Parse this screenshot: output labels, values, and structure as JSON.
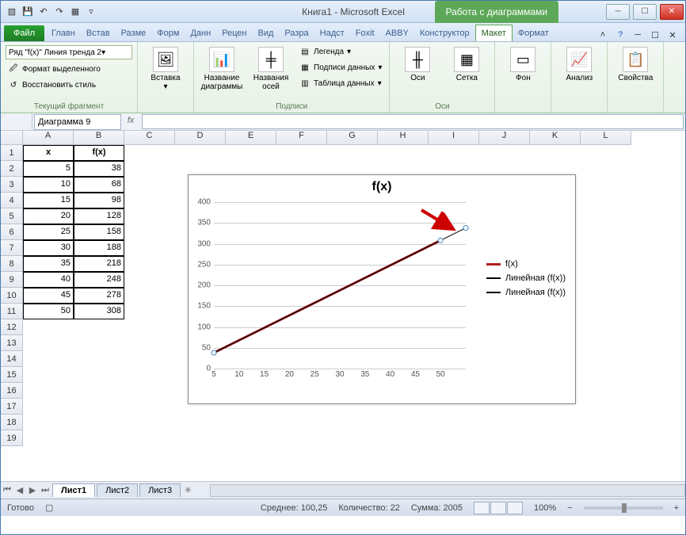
{
  "window": {
    "title_doc": "Книга1",
    "title_app": "Microsoft Excel",
    "chart_tools": "Работа с диаграммами"
  },
  "tabs": {
    "file": "Файл",
    "items": [
      "Главн",
      "Встав",
      "Разме",
      "Форм",
      "Данн",
      "Рецен",
      "Вид",
      "Разра",
      "Надст",
      "Foxit",
      "ABBY"
    ],
    "chart_ctx": [
      "Конструктор",
      "Макет",
      "Формат"
    ],
    "active": "Макет"
  },
  "ribbon": {
    "selection_combo": "Ряд \"f(x)\" Линия тренда 2",
    "format_selection": "Формат выделенного",
    "reset_style": "Восстановить стиль",
    "group_current": "Текущий фрагмент",
    "insert": "Вставка",
    "chart_title": "Название диаграммы",
    "axis_titles": "Названия осей",
    "legend": "Легенда",
    "data_labels": "Подписи данных",
    "data_table": "Таблица данных",
    "group_labels": "Подписи",
    "axes": "Оси",
    "gridlines": "Сетка",
    "group_axes": "Оси",
    "background": "Фон",
    "analysis": "Анализ",
    "properties": "Свойства"
  },
  "namebox": "Диаграмма 9",
  "sheet": {
    "headers": {
      "A": "x",
      "B": "f(x)"
    },
    "rows": [
      {
        "x": 5,
        "fx": 38
      },
      {
        "x": 10,
        "fx": 68
      },
      {
        "x": 15,
        "fx": 98
      },
      {
        "x": 20,
        "fx": 128
      },
      {
        "x": 25,
        "fx": 158
      },
      {
        "x": 30,
        "fx": 188
      },
      {
        "x": 35,
        "fx": 218
      },
      {
        "x": 40,
        "fx": 248
      },
      {
        "x": 45,
        "fx": 278
      },
      {
        "x": 50,
        "fx": 308
      }
    ],
    "col_letters": [
      "A",
      "B",
      "C",
      "D",
      "E",
      "F",
      "G",
      "H",
      "I",
      "J",
      "K",
      "L"
    ]
  },
  "chart_data": {
    "type": "line",
    "title": "f(x)",
    "x": [
      5,
      10,
      15,
      20,
      25,
      30,
      35,
      40,
      45,
      50
    ],
    "series": [
      {
        "name": "f(x)",
        "values": [
          38,
          68,
          98,
          128,
          158,
          188,
          218,
          248,
          278,
          308
        ],
        "color": "#b02020",
        "width": 3
      },
      {
        "name": "Линейная (f(x))",
        "values": [
          38,
          68,
          98,
          128,
          158,
          188,
          218,
          248,
          278,
          308
        ],
        "color": "#000",
        "width": 1
      },
      {
        "name": "Линейная (f(x))",
        "values": [
          38,
          68,
          98,
          128,
          158,
          188,
          218,
          248,
          278,
          308,
          338
        ],
        "x_ext": [
          5,
          10,
          15,
          20,
          25,
          30,
          35,
          40,
          45,
          50,
          55
        ],
        "color": "#000",
        "width": 1,
        "forecast": true
      }
    ],
    "yticks": [
      0,
      50,
      100,
      150,
      200,
      250,
      300,
      350,
      400
    ],
    "xticks": [
      5,
      10,
      15,
      20,
      25,
      30,
      35,
      40,
      45,
      50
    ],
    "ylim": [
      0,
      400
    ],
    "xlim": [
      5,
      55
    ],
    "legend": [
      "f(x)",
      "Линейная (f(x))",
      "Линейная (f(x))"
    ]
  },
  "sheets": {
    "tabs": [
      "Лист1",
      "Лист2",
      "Лист3"
    ],
    "active": "Лист1"
  },
  "status": {
    "ready": "Готово",
    "avg_lbl": "Среднее:",
    "avg": "100,25",
    "count_lbl": "Количество:",
    "count": "22",
    "sum_lbl": "Сумма:",
    "sum": "2005",
    "zoom": "100%"
  }
}
